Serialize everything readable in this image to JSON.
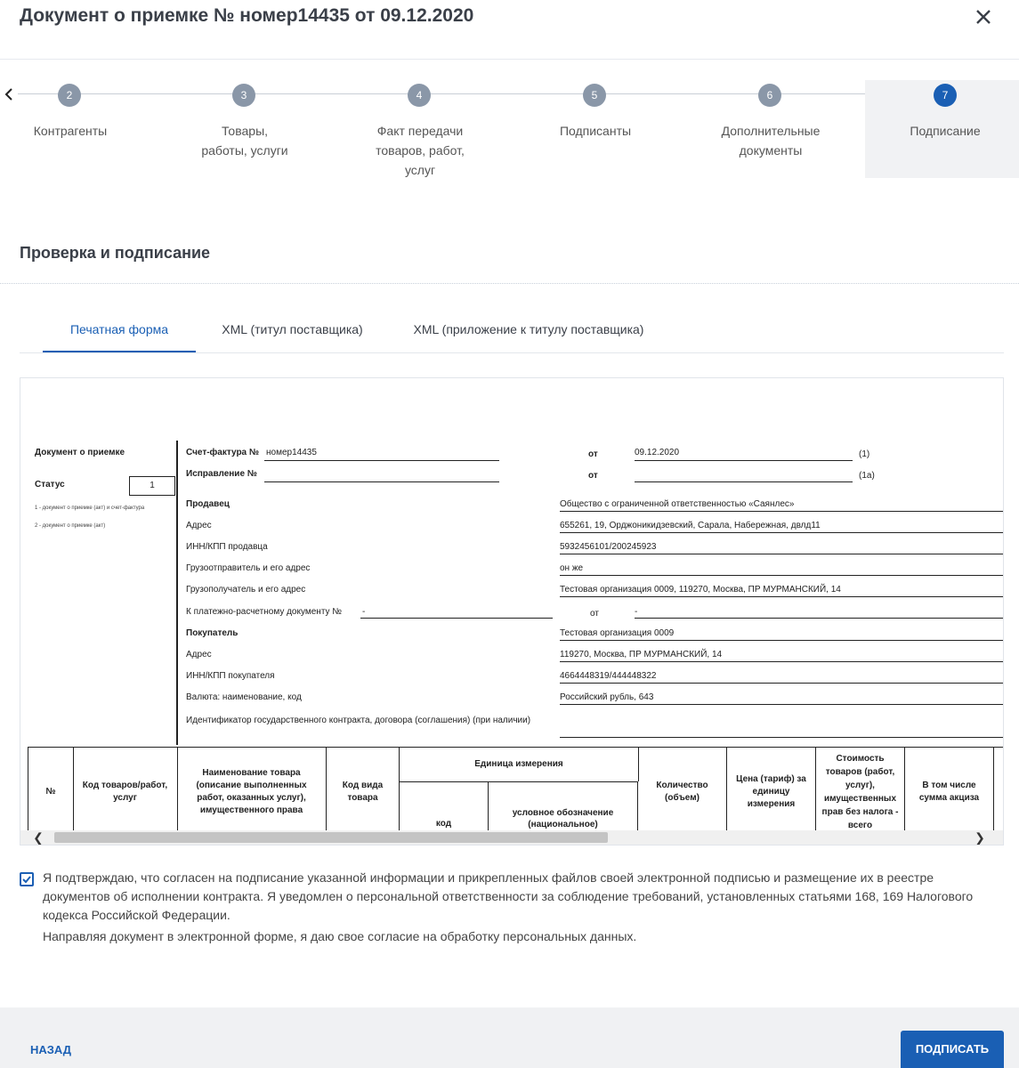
{
  "header": {
    "title": "Документ о приемке № номер14435 от 09.12.2020",
    "close_icon": "close-icon"
  },
  "steps": [
    {
      "num": "2",
      "label": "Контрагенты"
    },
    {
      "num": "3",
      "label": "Товары, работы, услуги"
    },
    {
      "num": "4",
      "label": "Факт передачи товаров, работ, услуг"
    },
    {
      "num": "5",
      "label": "Подписанты"
    },
    {
      "num": "6",
      "label": "Дополнительные документы"
    },
    {
      "num": "7",
      "label": "Подписание",
      "active": true
    }
  ],
  "section_title": "Проверка и подписание",
  "tabs": [
    {
      "label": "Печатная форма",
      "active": true
    },
    {
      "label": "XML (титул поставщика)"
    },
    {
      "label": "XML (приложение к титулу поставщика)"
    }
  ],
  "document": {
    "left": {
      "title": "Документ о приемке",
      "status_label": "Статус",
      "status_value": "1",
      "note1": "1 - документ о приемке (акт) и счет-фактура",
      "note2": "2 - документ о приемке (акт)"
    },
    "invoice_label": "Счет-фактура №",
    "invoice_value": "номер14435",
    "from_label": "от",
    "invoice_date": "09.12.2020",
    "mark1": "(1)",
    "correction_label": "Исправление №",
    "mark1a": "(1а)",
    "seller_label": "Продавец",
    "seller_value": "Общество с ограниченной ответственностью «Саянлес»",
    "seller_address_label": "Адрес",
    "seller_address_value": "655261, 19, Орджоникидзевский, Сарала, Набережная, двлд11",
    "seller_inn_label": "ИНН/КПП продавца",
    "seller_inn_value": "5932456101/200245923",
    "shipper_label": "Грузоотправитель и его адрес",
    "shipper_value": "он же",
    "consignee_label": "Грузополучатель и его адрес",
    "consignee_value": "Тестовая организация 0009, 119270, Москва, ПР МУРМАНСКИЙ, 14",
    "payment_label": "К платежно-расчетному документу №",
    "payment_value": "-",
    "payment_from_label": "от",
    "payment_from_value": "-",
    "buyer_label": "Покупатель",
    "buyer_value": "Тестовая организация 0009",
    "buyer_address_label": "Адрес",
    "buyer_address_value": "119270, Москва, ПР МУРМАНСКИЙ, 14",
    "buyer_inn_label": "ИНН/КПП покупателя",
    "buyer_inn_value": "4664448319/444448322",
    "currency_label": "Валюта: наименование, код",
    "currency_value": "Российский рубль, 643",
    "contract_id_label": "Идентификатор государственного контракта, договора (соглашения) (при наличии)",
    "table_headers": [
      "№",
      "Код товаров/работ, услуг",
      "Наименование товара (описание выполненных работ, оказанных услуг), имущественного права",
      "Код вида товара",
      "Единица измерения",
      "код",
      "условное обозначение (национальное)",
      "Количество (объем)",
      "Цена (тариф) за единицу измерения",
      "Стоимость товаров (работ, услуг), имущественных прав без налога - всего",
      "В том числе сумма акциза"
    ]
  },
  "agreement": {
    "checked": true,
    "text1": "Я подтверждаю, что согласен на подписание указанной информации и прикрепленных файлов своей электронной подписью и размещение их в реестре документов об исполнении контракта. Я уведомлен о персональной ответственности за соблюдение требований, установленных статьями 168, 169 Налогового кодекса Российской Федерации.",
    "text2": "Направляя документ в электронной форме, я даю свое согласие на обработку персональных данных."
  },
  "footer": {
    "back_label": "НАЗАД",
    "sign_label": "ПОДПИСАТЬ"
  },
  "colors": {
    "accent": "#1a5fb4",
    "step_inactive": "#8a97a8",
    "footer_bg": "#f0f1f3"
  }
}
